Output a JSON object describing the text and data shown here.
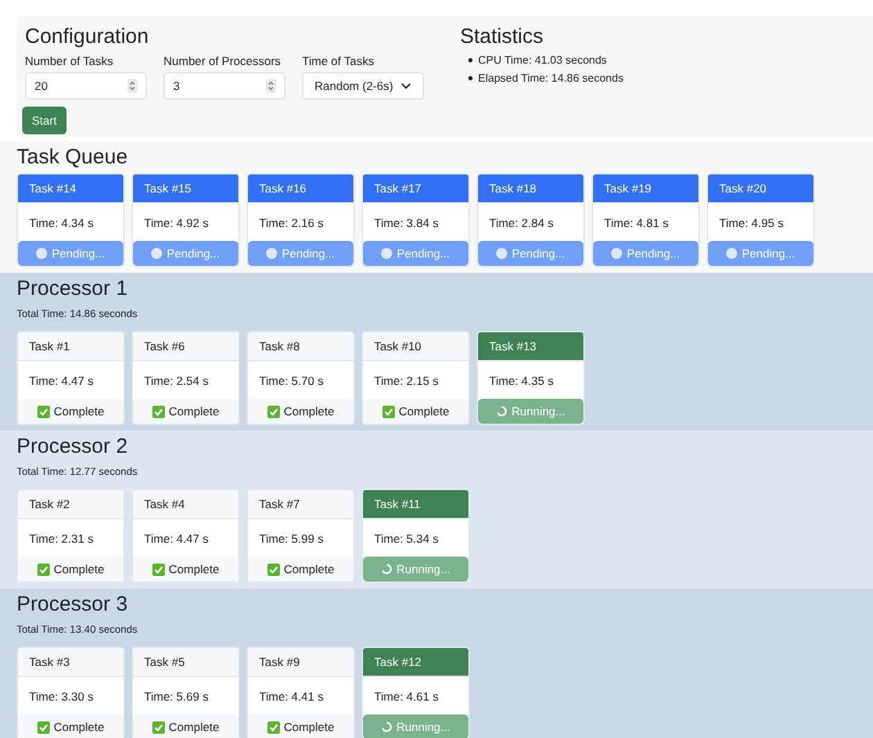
{
  "configuration": {
    "title": "Configuration",
    "fields": [
      {
        "kind": "number",
        "label": "Number of Tasks",
        "value": "20"
      },
      {
        "kind": "number",
        "label": "Number of Processors",
        "value": "3"
      },
      {
        "kind": "select",
        "label": "Time of Tasks",
        "value": "Random (2-6s)"
      }
    ],
    "start_button": "Start"
  },
  "statistics": {
    "title": "Statistics",
    "items": [
      "CPU Time: 41.03 seconds",
      "Elapsed Time: 14.86 seconds"
    ]
  },
  "sections": [
    {
      "kind": "queue",
      "title": "Task Queue",
      "tasks": [
        {
          "name": "Task #14",
          "time": "Time: 4.34 s",
          "kind": "pending",
          "status_text": "Pending..."
        },
        {
          "name": "Task #15",
          "time": "Time: 4.92 s",
          "kind": "pending",
          "status_text": "Pending..."
        },
        {
          "name": "Task #16",
          "time": "Time: 2.16 s",
          "kind": "pending",
          "status_text": "Pending..."
        },
        {
          "name": "Task #17",
          "time": "Time: 3.84 s",
          "kind": "pending",
          "status_text": "Pending..."
        },
        {
          "name": "Task #18",
          "time": "Time: 2.84 s",
          "kind": "pending",
          "status_text": "Pending..."
        },
        {
          "name": "Task #19",
          "time": "Time: 4.81 s",
          "kind": "pending",
          "status_text": "Pending..."
        },
        {
          "name": "Task #20",
          "time": "Time: 4.95 s",
          "kind": "pending",
          "status_text": "Pending..."
        }
      ]
    },
    {
      "kind": "processor",
      "title": "Processor 1",
      "total": "Total Time: 14.86 seconds",
      "tasks": [
        {
          "name": "Task #1",
          "time": "Time: 4.47 s",
          "kind": "complete",
          "status_text": "Complete"
        },
        {
          "name": "Task #6",
          "time": "Time: 2.54 s",
          "kind": "complete",
          "status_text": "Complete"
        },
        {
          "name": "Task #8",
          "time": "Time: 5.70 s",
          "kind": "complete",
          "status_text": "Complete"
        },
        {
          "name": "Task #10",
          "time": "Time: 2.15 s",
          "kind": "complete",
          "status_text": "Complete"
        },
        {
          "name": "Task #13",
          "time": "Time: 4.35 s",
          "kind": "running",
          "status_text": "Running..."
        }
      ]
    },
    {
      "kind": "processor",
      "title": "Processor 2",
      "total": "Total Time: 12.77 seconds",
      "tasks": [
        {
          "name": "Task #2",
          "time": "Time: 2.31 s",
          "kind": "complete",
          "status_text": "Complete"
        },
        {
          "name": "Task #4",
          "time": "Time: 4.47 s",
          "kind": "complete",
          "status_text": "Complete"
        },
        {
          "name": "Task #7",
          "time": "Time: 5.99 s",
          "kind": "complete",
          "status_text": "Complete"
        },
        {
          "name": "Task #11",
          "time": "Time: 5.34 s",
          "kind": "running",
          "status_text": "Running..."
        }
      ]
    },
    {
      "kind": "processor",
      "title": "Processor 3",
      "total": "Total Time: 13.40 seconds",
      "tasks": [
        {
          "name": "Task #3",
          "time": "Time: 3.30 s",
          "kind": "complete",
          "status_text": "Complete"
        },
        {
          "name": "Task #5",
          "time": "Time: 5.69 s",
          "kind": "complete",
          "status_text": "Complete"
        },
        {
          "name": "Task #9",
          "time": "Time: 4.41 s",
          "kind": "complete",
          "status_text": "Complete"
        },
        {
          "name": "Task #12",
          "time": "Time: 4.61 s",
          "kind": "running",
          "status_text": "Running..."
        }
      ]
    }
  ]
}
